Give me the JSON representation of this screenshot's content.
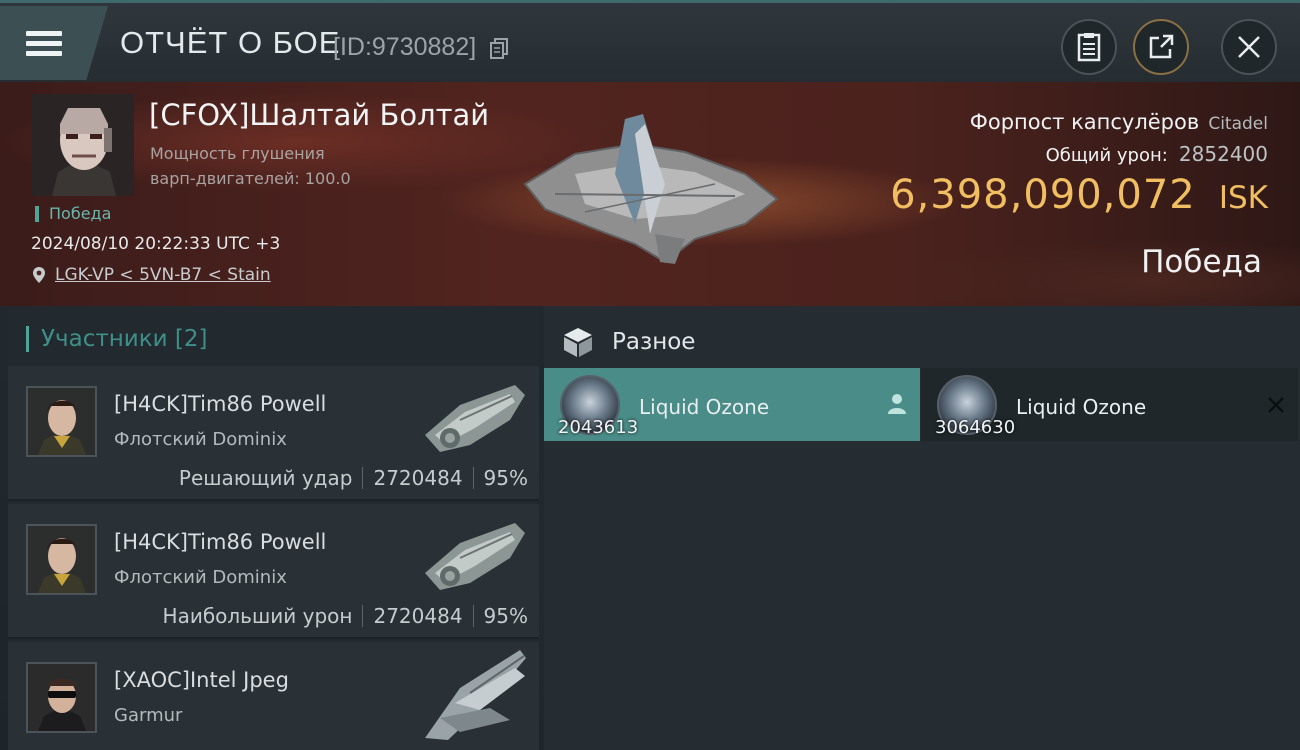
{
  "header": {
    "menu_icon": "hamburger-menu-icon",
    "title": "ОТЧЁТ О БОЕ",
    "report_id": "[ID:9730882]",
    "copy_icon": "copy-icon",
    "buttons": [
      {
        "name": "clipboard-button",
        "icon": "clipboard-icon"
      },
      {
        "name": "share-button",
        "icon": "share-icon"
      },
      {
        "name": "close-button",
        "icon": "close-icon"
      }
    ]
  },
  "victim": {
    "name": "[CFOX]Шалтай Болтай",
    "stat_line1": "Мощность глушения",
    "stat_line2": "варп-двигателей: 100.0",
    "result_badge": "Победа",
    "datetime": "2024/08/10 20:22:33 UTC +3",
    "location": "LGK-VP < 5VN-B7 < Stain",
    "location_icon": "map-pin-icon"
  },
  "target": {
    "name": "Форпост капсулёров",
    "type": "Citadel",
    "damage_label": "Общий урон:",
    "damage_value": "2852400",
    "isk_value": "6,398,090,072",
    "isk_unit": "ISK",
    "outcome": "Победа"
  },
  "participants": {
    "header": "Участники [2]",
    "rows": [
      {
        "name": "[H4CK]Tim86 Powell",
        "ship": "Флотский Dominix",
        "role": "Решающий удар",
        "damage": "2720484",
        "percent": "95%"
      },
      {
        "name": "[H4CK]Tim86 Powell",
        "ship": "Флотский Dominix",
        "role": "Наибольший урон",
        "damage": "2720484",
        "percent": "95%"
      },
      {
        "name": "[XAOC]Intel Jpeg",
        "ship": "Garmur"
      }
    ]
  },
  "items": {
    "title": "Разное",
    "icon": "cube-icon",
    "cards": [
      {
        "name": "Liquid Ozone",
        "qty": "2043613",
        "selected": true,
        "marker_icon": "person-icon"
      },
      {
        "name": "Liquid Ozone",
        "qty": "3064630",
        "selected": false,
        "marker_icon": "close-x-icon"
      }
    ]
  },
  "colors": {
    "accent_teal": "#4fa598",
    "isk_gold": "#f1bf62",
    "selected_card": "#4a8c88"
  }
}
